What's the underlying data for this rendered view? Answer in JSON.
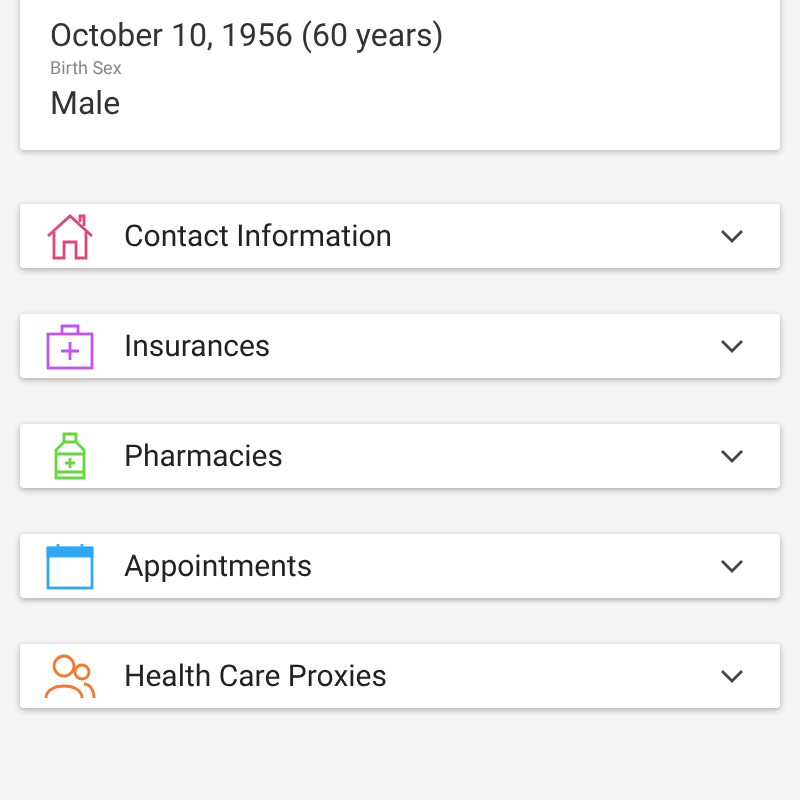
{
  "profile": {
    "fields": [
      {
        "value": "October 10, 1956 (60 years)"
      },
      {
        "label": "Birth Sex",
        "value": "Male"
      }
    ]
  },
  "sections": [
    {
      "kind": "house",
      "label": "Contact Information",
      "color": "#e0457b",
      "expanded": false
    },
    {
      "kind": "insurance",
      "label": "Insurances",
      "color": "#c452ee",
      "expanded": false
    },
    {
      "kind": "pharmacy",
      "label": "Pharmacies",
      "color": "#62d83a",
      "expanded": false
    },
    {
      "kind": "calendar",
      "label": "Appointments",
      "color": "#2ea8f2",
      "expanded": false
    },
    {
      "kind": "people",
      "label": "Health Care Proxies",
      "color": "#f5782c",
      "expanded": false
    }
  ]
}
